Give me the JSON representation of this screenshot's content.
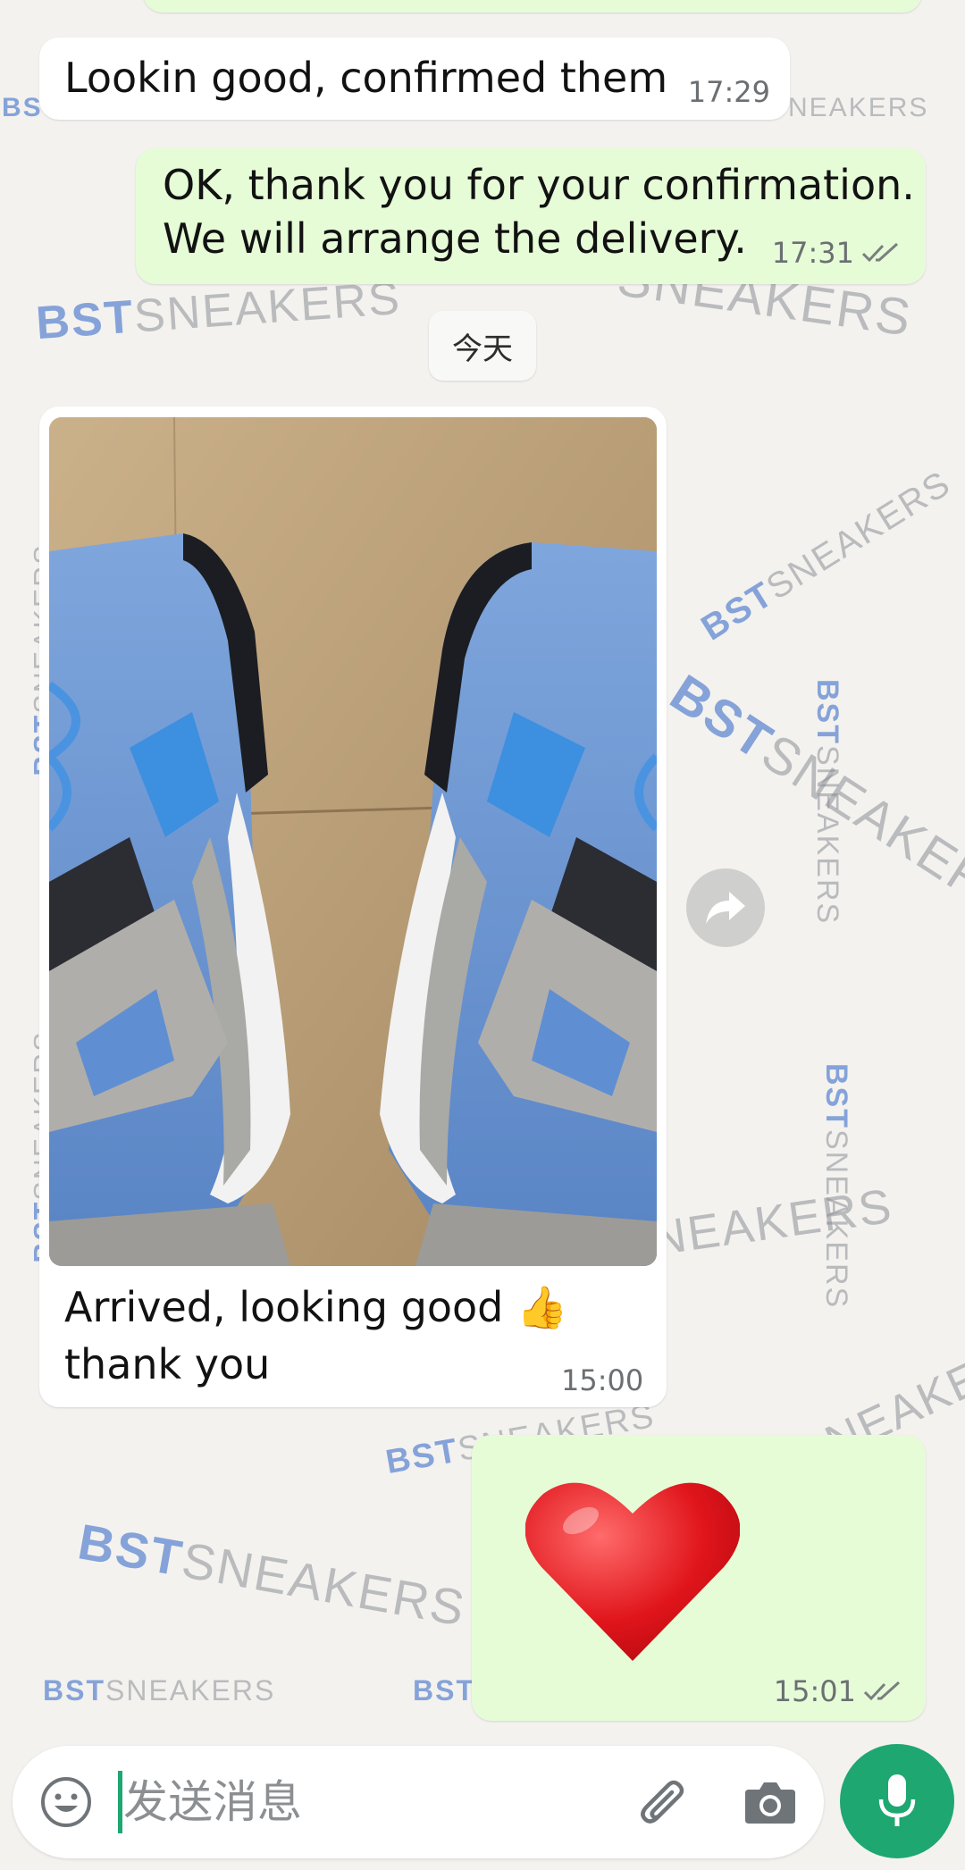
{
  "watermark": {
    "brand_a": "BST",
    "brand_b": "SNEAKERS"
  },
  "messages": [
    {
      "text": "Lookin good, confirmed them",
      "time": "17:29"
    },
    {
      "line1": "OK, thank you for your confirmation.",
      "line2": "We will arrange the delivery.",
      "time": "17:31"
    },
    {
      "line1": "Arrived, looking good 👍",
      "line2": "thank you",
      "time": "15:00"
    },
    {
      "time": "15:01"
    }
  ],
  "date_divider": "今天",
  "composer": {
    "placeholder": "发送消息"
  },
  "icons": [
    "emoji-icon",
    "attach-icon",
    "camera-icon",
    "mic-icon",
    "forward-icon",
    "read-ticks-icon",
    "heart-emoji"
  ],
  "colors": {
    "incoming": "#ffffff",
    "outgoing": "#e6fcd7",
    "accent": "#1ea771",
    "background": "#f4f2ef"
  }
}
